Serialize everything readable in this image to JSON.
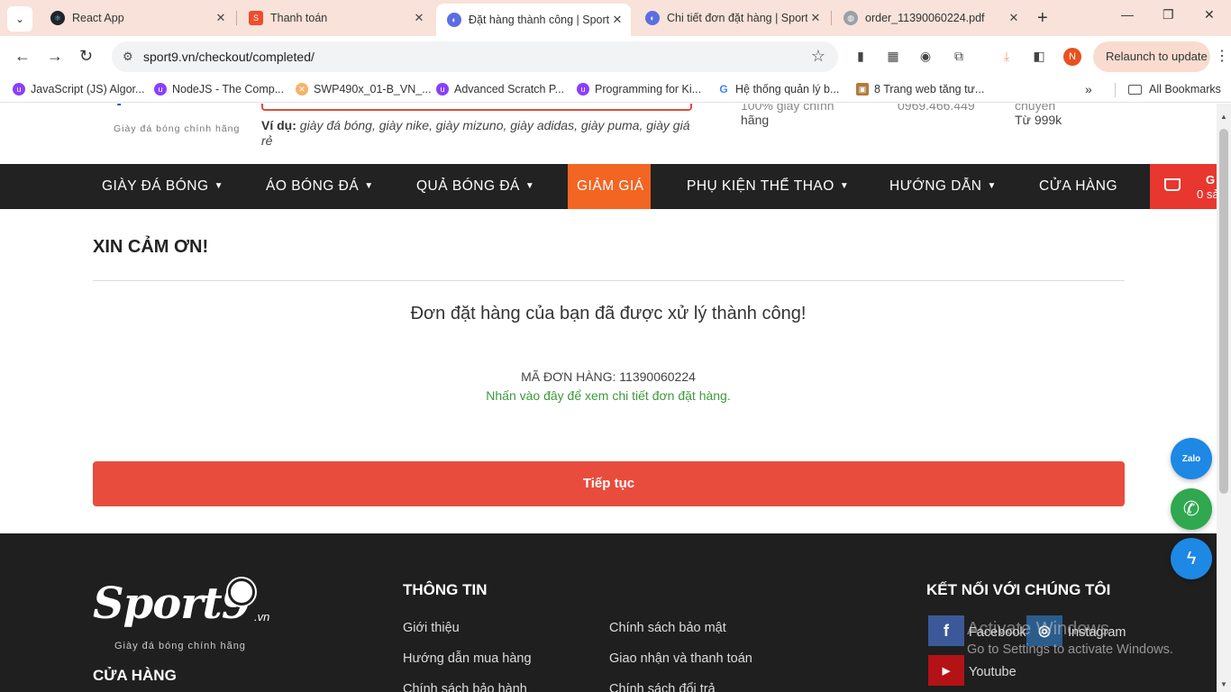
{
  "browser": {
    "tabs": [
      {
        "title": "React App",
        "active": false
      },
      {
        "title": "Thanh toán",
        "active": false
      },
      {
        "title": "Đặt hàng thành công | Sport9",
        "active": true
      },
      {
        "title": "Chi tiết đơn đặt hàng | Sport9",
        "active": false
      },
      {
        "title": "order_11390060224.pdf",
        "active": false
      }
    ],
    "url": "sport9.vn/checkout/completed/",
    "profile_initial": "N",
    "relaunch_label": "Relaunch to update",
    "bookmarks": [
      "JavaScript (JS) Algor...",
      "NodeJS - The Comp...",
      "SWP490x_01-B_VN_...",
      "Advanced Scratch P...",
      "Programming for Ki...",
      "Hệ thống quản lý b...",
      "8 Trang web tăng tư..."
    ],
    "all_bookmarks_label": "All Bookmarks"
  },
  "site": {
    "logo_tagline": "Giày đá bóng chính hãng",
    "search_example_label": "Ví dụ:",
    "search_example_text": "giày đá bóng, giày nike, giày mizuno, giày adidas, giày puma, giày giá rẻ",
    "header_info": [
      {
        "line1": "100% giày chính",
        "line2": "hãng"
      },
      {
        "line1": "0969.466.449",
        "line2": ""
      },
      {
        "line1": "chuyển",
        "line2": "Từ 999k"
      }
    ],
    "nav": [
      {
        "label": "GIÀY ĐÁ BÓNG",
        "has_dropdown": true
      },
      {
        "label": "ÁO BÓNG ĐÁ",
        "has_dropdown": true
      },
      {
        "label": "QUẢ BÓNG ĐÁ",
        "has_dropdown": true
      },
      {
        "label": "GIẢM GIÁ",
        "has_dropdown": false
      },
      {
        "label": "PHỤ KIỆN THỂ THAO",
        "has_dropdown": true
      },
      {
        "label": "HƯỚNG DẪN",
        "has_dropdown": true
      },
      {
        "label": "CỬA HÀNG",
        "has_dropdown": false
      }
    ],
    "cart": {
      "label": "G",
      "count": "0 sả"
    }
  },
  "content": {
    "thanks_title": "XIN CẢM ƠN!",
    "success_message": "Đơn đặt hàng của bạn đã được xử lý thành công!",
    "order_code": "MÃ ĐƠN HÀNG: 11390060224",
    "order_detail_link": "Nhấn vào đây để xem chi tiết đơn đặt hàng.",
    "continue_button": "Tiếp tục"
  },
  "footer": {
    "logo_text": "Sport9",
    "logo_suffix": ".vn",
    "logo_tagline": "Giày đá bóng chính hãng",
    "store_heading": "CỬA HÀNG",
    "info_heading": "THÔNG TIN",
    "info_links_col1": [
      "Giới thiệu",
      "Hướng dẫn mua hàng",
      "Chính sách bảo hành"
    ],
    "info_links_col2": [
      "Chính sách bảo mật",
      "Giao nhận và thanh toán",
      "Chính sách đổi trả"
    ],
    "connect_heading": "KẾT NỐI VỚI CHÚNG TÔI",
    "social": {
      "facebook": "Facebook",
      "instagram": "Instagram",
      "youtube": "Youtube"
    }
  },
  "os_watermark": {
    "line1": "Activate Windows",
    "line2": "Go to Settings to activate Windows."
  },
  "floating": {
    "zalo_label": "Zalo"
  },
  "colors": {
    "tabstrip": "#f8e2d9",
    "nav_bg": "#222222",
    "sale": "#f26522",
    "cart": "#e8372e",
    "continue_button": "#e84c3d",
    "success_link": "#3c9a3c",
    "footer_bg": "#1f1f1f"
  }
}
